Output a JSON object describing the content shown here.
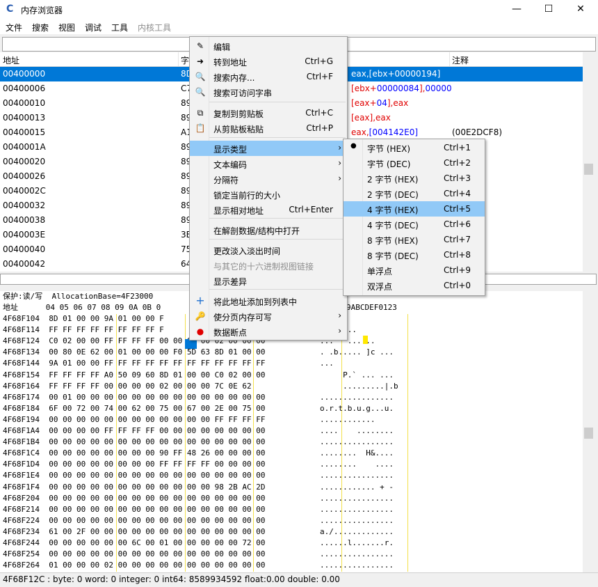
{
  "window": {
    "title": "内存浏览器",
    "minimize": "—",
    "maximize": "☐",
    "close": "✕"
  },
  "menubar": [
    "文件",
    "搜索",
    "视图",
    "调试",
    "工具",
    "内核工具"
  ],
  "disasm": {
    "headers": {
      "address": "地址",
      "bytes": "字",
      "comment": "注释"
    },
    "rows": [
      {
        "addr": "00400000",
        "bytes": "8D",
        "selected": true
      },
      {
        "addr": "00400006",
        "bytes": "C7"
      },
      {
        "addr": "00400010",
        "bytes": "89"
      },
      {
        "addr": "00400013",
        "bytes": "89"
      },
      {
        "addr": "00400015",
        "bytes": "A1"
      },
      {
        "addr": "0040001A",
        "bytes": "89"
      },
      {
        "addr": "00400020",
        "bytes": "89"
      },
      {
        "addr": "00400026",
        "bytes": "89"
      },
      {
        "addr": "0040002C",
        "bytes": "89"
      },
      {
        "addr": "00400032",
        "bytes": "89"
      },
      {
        "addr": "00400038",
        "bytes": "89"
      },
      {
        "addr": "0040003E",
        "bytes": "3E"
      },
      {
        "addr": "00400040",
        "bytes": "75"
      },
      {
        "addr": "00400042",
        "bytes": "64"
      }
    ],
    "operands": [
      {
        "parts": [
          [
            "eax",
            "w"
          ],
          [
            ",[",
            "w"
          ],
          [
            "ebx",
            "w"
          ],
          [
            "+",
            "w"
          ],
          [
            "00000194",
            "w"
          ],
          [
            "]",
            "w"
          ]
        ]
      },
      {
        "parts": [
          [
            "[",
            "r"
          ],
          [
            "ebx",
            "r"
          ],
          [
            "+",
            "r"
          ],
          [
            "00000084",
            "b"
          ],
          [
            "],",
            "r"
          ],
          [
            "00000",
            "b"
          ]
        ]
      },
      {
        "parts": [
          [
            "[",
            "r"
          ],
          [
            "eax",
            "r"
          ],
          [
            "+",
            "r"
          ],
          [
            "04",
            "b"
          ],
          [
            "],",
            "r"
          ],
          [
            "eax",
            "r"
          ]
        ]
      },
      {
        "parts": [
          [
            "[eax]",
            "r"
          ],
          [
            ",",
            "r"
          ],
          [
            "eax",
            "r"
          ]
        ]
      },
      {
        "parts": [
          [
            "eax",
            "r"
          ],
          [
            ",",
            "r"
          ],
          [
            "[004142E0]",
            "b"
          ]
        ],
        "comment": "(00E2DCF8)"
      }
    ]
  },
  "hex": {
    "protect_line": "保护:读/写  AllocationBase=4F23000",
    "header_line": "地址      04 05 06 07 08 09 0A 0B 0",
    "ascii_header": "9ABCDEF0123",
    "lines": [
      {
        "a": "4F68F104",
        "h": "8D 01 00 00 9A 01 00 00 F",
        "t": "...."
      },
      {
        "a": "4F68F114",
        "h": "FF FF FF FF FF FF FF FF F",
        "t": ".Q.` ..."
      },
      {
        "a": "4F68F124",
        "h": "C0 02 00 00 FF FF FF FF 00 00 00 00 02 00 00 00",
        "t": "...   ......"
      },
      {
        "a": "4F68F134",
        "h": "00 80 0E 62 00 01 00 00 00 F0 5D 63 8D 01 00 00",
        "t": ". .b..... ]c ..."
      },
      {
        "a": "4F68F144",
        "h": "9A 01 00 00 FF FF FF FF FF FF FF FF FF FF FF FF",
        "t": "..."
      },
      {
        "a": "4F68F154",
        "h": "FF FF FF FF A0 50 09 60 8D 01 00 00 C0 02 00 00",
        "t": "     P.` ... ..."
      },
      {
        "a": "4F68F164",
        "h": "FF FF FF FF 00 00 00 00 02 00 00 00 7C 0E 62",
        "t": "     .........|.b"
      },
      {
        "a": "4F68F174",
        "h": "00 01 00 00 00 00 00 00 00 00 00 00 00 00 00 00",
        "t": "................"
      },
      {
        "a": "4F68F184",
        "h": "6F 00 72 00 74 00 62 00 75 00 67 00 2E 00 75 00",
        "t": "o.r.t.b.u.g...u."
      },
      {
        "a": "4F68F194",
        "h": "00 00 00 00 00 00 00 00 00 00 00 00 FF FF FF FF",
        "t": "............"
      },
      {
        "a": "4F68F1A4",
        "h": "00 00 00 00 FF FF FF FF 00 00 00 00 00 00 00 00",
        "t": "....    ........"
      },
      {
        "a": "4F68F1B4",
        "h": "00 00 00 00 00 00 00 00 00 00 00 00 00 00 00 00",
        "t": "................"
      },
      {
        "a": "4F68F1C4",
        "h": "00 00 00 00 00 00 00 00 90 FF 48 26 00 00 00 00",
        "t": "........  H&...."
      },
      {
        "a": "4F68F1D4",
        "h": "00 00 00 00 00 00 00 00 FF FF FF FF 00 00 00 00",
        "t": "........    ...."
      },
      {
        "a": "4F68F1E4",
        "h": "00 00 00 00 00 00 00 00 00 00 00 00 00 00 00 00",
        "t": "................"
      },
      {
        "a": "4F68F1F4",
        "h": "00 00 00 00 00 00 00 00 00 00 00 00 98 2B AC 2D",
        "t": "............ + -"
      },
      {
        "a": "4F68F204",
        "h": "00 00 00 00 00 00 00 00 00 00 00 00 00 00 00 00",
        "t": "................"
      },
      {
        "a": "4F68F214",
        "h": "00 00 00 00 00 00 00 00 00 00 00 00 00 00 00 00",
        "t": "................"
      },
      {
        "a": "4F68F224",
        "h": "00 00 00 00 00 00 00 00 00 00 00 00 00 00 00 00",
        "t": "................"
      },
      {
        "a": "4F68F234",
        "h": "61 00 2F 00 00 00 00 00 00 00 00 00 00 00 00 00",
        "t": "a./............."
      },
      {
        "a": "4F68F244",
        "h": "00 00 00 00 00 00 6C 00 01 00 00 00 00 00 72 00",
        "t": "......l.......r."
      },
      {
        "a": "4F68F254",
        "h": "00 00 00 00 00 00 00 00 00 00 00 00 00 00 00 00",
        "t": "................"
      },
      {
        "a": "4F68F264",
        "h": "01 00 00 00 02 00 00 00 00 00 00 00 00 00 00 00",
        "t": "................"
      }
    ]
  },
  "status": "4F68F12C : byte: 0 word: 0 integer: 0 int64: 8589934592 float:0.00 double: 0.00",
  "context_menu": {
    "items": [
      {
        "label": "编辑",
        "icon": "edit-icon",
        "glyph": "✎"
      },
      {
        "label": "转到地址",
        "shortcut": "Ctrl+G",
        "icon": "goto-icon",
        "glyph": "➜"
      },
      {
        "label": "搜索内存...",
        "shortcut": "Ctrl+F",
        "icon": "search-icon",
        "glyph": "🔍"
      },
      {
        "label": "搜索可访问字串",
        "icon": "search-string-icon",
        "glyph": "🔍"
      },
      {
        "label": "复制到剪贴板",
        "shortcut": "Ctrl+C",
        "icon": "copy-icon",
        "glyph": "⧉"
      },
      {
        "label": "从剪贴板粘贴",
        "shortcut": "Ctrl+P",
        "icon": "paste-icon",
        "glyph": "📋"
      },
      {
        "label": "显示类型",
        "submenu": true,
        "highlight": true
      },
      {
        "label": "文本编码",
        "submenu": true
      },
      {
        "label": "分隔符",
        "submenu": true
      },
      {
        "label": "锁定当前行的大小"
      },
      {
        "label": "显示相对地址",
        "shortcut": "Ctrl+Enter"
      },
      {
        "label": "在解剖数据/结构中打开"
      },
      {
        "label": "更改淡入淡出时间"
      },
      {
        "label": "与其它的十六进制视图链接",
        "disabled": true
      },
      {
        "label": "显示差异"
      },
      {
        "label": "将此地址添加到列表中",
        "icon": "add-icon",
        "glyph": "+"
      },
      {
        "label": "使分页内存可写",
        "submenu": true,
        "icon": "key-icon",
        "glyph": "🔑"
      },
      {
        "label": "数据断点",
        "submenu": true,
        "icon": "breakpoint-icon",
        "glyph": "●"
      }
    ]
  },
  "submenu": {
    "items": [
      {
        "label": "字节 (HEX)",
        "shortcut": "Ctrl+1",
        "checked": true
      },
      {
        "label": "字节 (DEC)",
        "shortcut": "Ctrl+2"
      },
      {
        "label": "2 字节 (HEX)",
        "shortcut": "Ctrl+3"
      },
      {
        "label": "2 字节 (DEC)",
        "shortcut": "Ctrl+4"
      },
      {
        "label": "4 字节 (HEX)",
        "shortcut": "Ctrl+5",
        "highlight": true
      },
      {
        "label": "4 字节 (DEC)",
        "shortcut": "Ctrl+6"
      },
      {
        "label": "8 字节 (HEX)",
        "shortcut": "Ctrl+7"
      },
      {
        "label": "8 字节 (DEC)",
        "shortcut": "Ctrl+8"
      },
      {
        "label": "单浮点",
        "shortcut": "Ctrl+9"
      },
      {
        "label": "双浮点",
        "shortcut": "Ctrl+0"
      }
    ]
  }
}
